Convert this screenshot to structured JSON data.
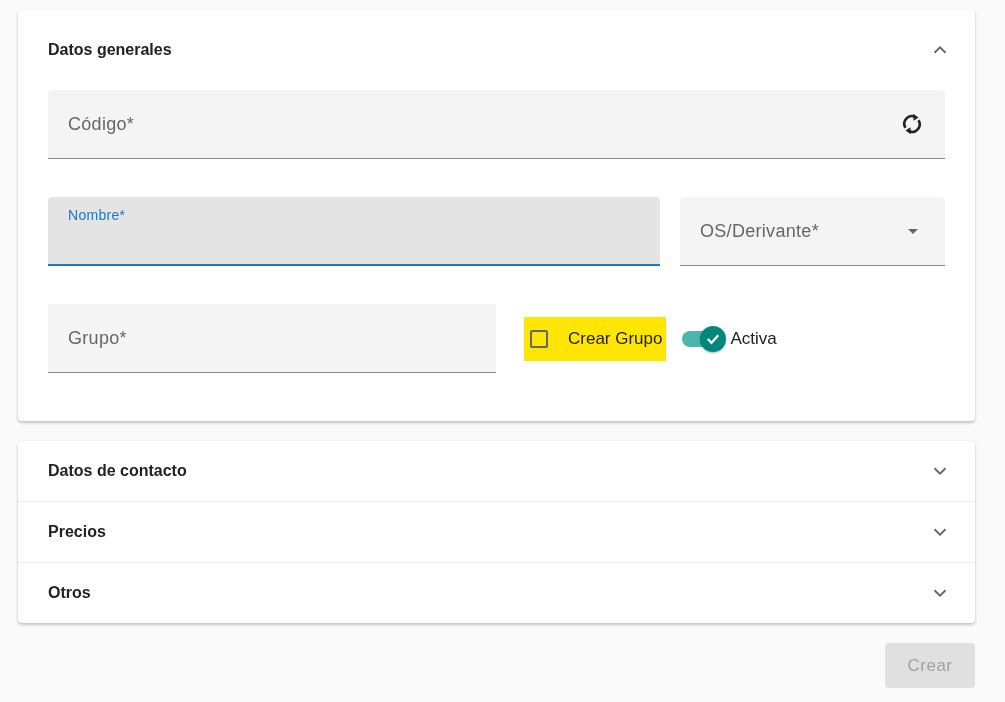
{
  "sections": [
    {
      "title": "Datos generales",
      "expanded": true,
      "fields": [
        {
          "kind": "refresh",
          "label": "Código*",
          "focused": false
        },
        {
          "kind": "text",
          "label": "Nombre*",
          "focused": true
        },
        {
          "kind": "select",
          "label": "OS/Derivante*",
          "focused": false
        },
        {
          "kind": "text",
          "label": "Grupo*",
          "focused": false
        },
        {
          "kind": "checkbox",
          "label": "Crear Grupo",
          "checked": false,
          "highlighted": true
        },
        {
          "kind": "switch",
          "label": "Activa",
          "on": true
        }
      ]
    },
    {
      "title": "Datos de contacto",
      "expanded": false
    },
    {
      "title": "Precios",
      "expanded": false
    },
    {
      "title": "Otros",
      "expanded": false
    }
  ],
  "create_button": {
    "label": "Crear",
    "disabled": true
  }
}
